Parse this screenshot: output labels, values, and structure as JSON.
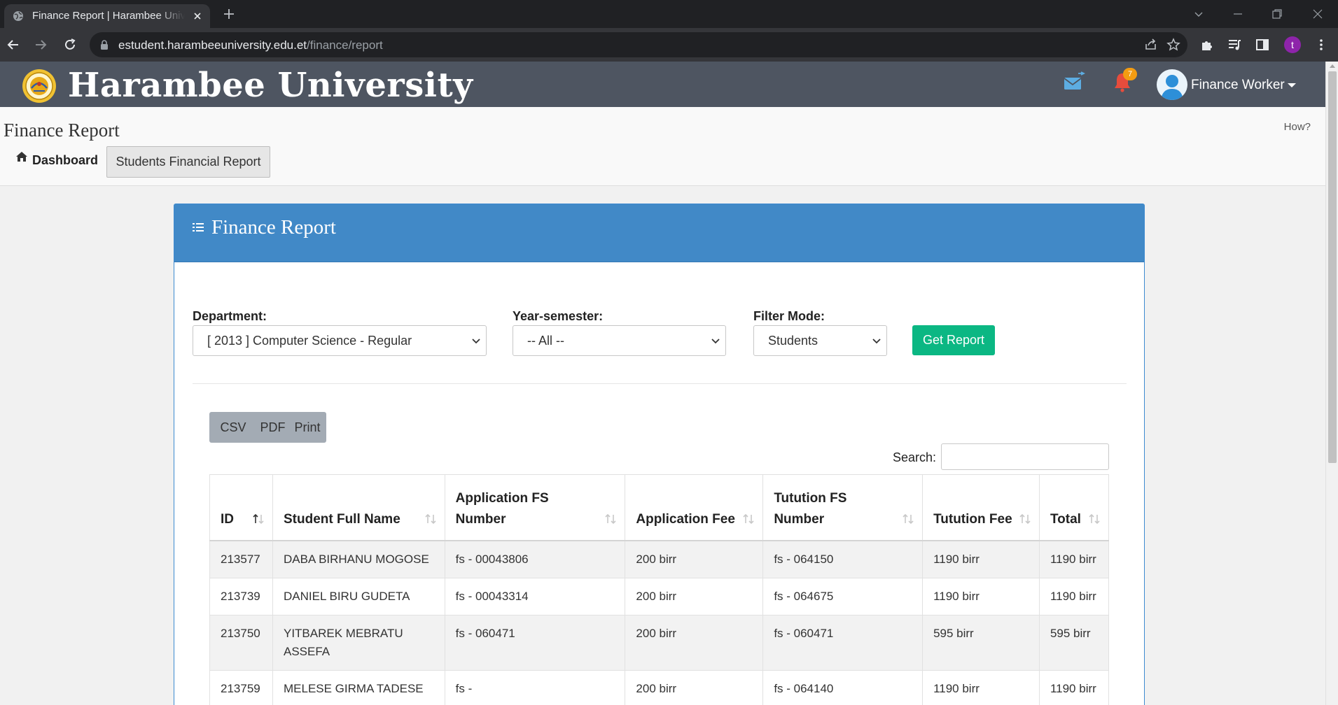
{
  "browser": {
    "tab_title": "Finance Report | Harambee University",
    "url_host": "estudent.harambeeuniversity.edu.et",
    "url_path": "/finance/report",
    "profile_initial": "t"
  },
  "header": {
    "brand": "Harambee University",
    "notification_count": "7",
    "user_name": "Finance Worker"
  },
  "subheader": {
    "page_title": "Finance Report",
    "how_link": "How?",
    "breadcrumb_home": "Dashboard",
    "breadcrumb_active": "Students Financial Report"
  },
  "card": {
    "title": "Finance Report"
  },
  "filters": {
    "department_label": "Department:",
    "department_value": "[ 2013 ] Computer Science - Regular",
    "year_label": "Year-semester:",
    "year_value": "-- All --",
    "mode_label": "Filter Mode:",
    "mode_value": "Students",
    "submit_label": "Get Report"
  },
  "exports": [
    "CSV",
    "PDF",
    "Print"
  ],
  "search": {
    "label": "Search:",
    "value": ""
  },
  "table": {
    "columns": [
      {
        "label": "ID"
      },
      {
        "label": "Student Full Name"
      },
      {
        "label": "Application FS Number"
      },
      {
        "label": "Application Fee"
      },
      {
        "label": "Tutution FS Number"
      },
      {
        "label": "Tutution Fee"
      },
      {
        "label": "Total"
      }
    ],
    "rows": [
      {
        "id": "213577",
        "name": "DABA BIRHANU MOGOSE",
        "app_fs": "fs - 00043806",
        "app_fee": "200 birr",
        "tuition_fs": "fs - 064150",
        "tuition_fee": "1190 birr",
        "total": "1190 birr"
      },
      {
        "id": "213739",
        "name": "DANIEL BIRU GUDETA",
        "app_fs": "fs - 00043314",
        "app_fee": "200 birr",
        "tuition_fs": "fs - 064675",
        "tuition_fee": "1190 birr",
        "total": "1190 birr"
      },
      {
        "id": "213750",
        "name": "YITBAREK MEBRATU ASSEFA",
        "app_fs": "fs - 060471",
        "app_fee": "200 birr",
        "tuition_fs": "fs - 060471",
        "tuition_fee": "595 birr",
        "total": "595 birr"
      },
      {
        "id": "213759",
        "name": "MELESE GIRMA TADESE",
        "app_fs": "fs -",
        "app_fee": "200 birr",
        "tuition_fs": "fs - 064140",
        "tuition_fee": "1190 birr",
        "total": "1190 birr"
      }
    ]
  },
  "colors": {
    "browser_bg": "#202124",
    "header_bg": "#4e5561",
    "card_head": "#4189c7",
    "accent_green": "#0bb783",
    "badge_orange": "#f39c12"
  },
  "icons": [
    "globe-icon",
    "close-icon",
    "plus-icon",
    "back-icon",
    "forward-icon",
    "reload-icon",
    "lock-icon",
    "share-icon",
    "star-icon",
    "puzzle-icon",
    "media-icon",
    "sidepanel-icon",
    "mail-icon",
    "bell-icon",
    "home-icon",
    "list-icon",
    "chevron-down-icon",
    "sort-icon"
  ]
}
